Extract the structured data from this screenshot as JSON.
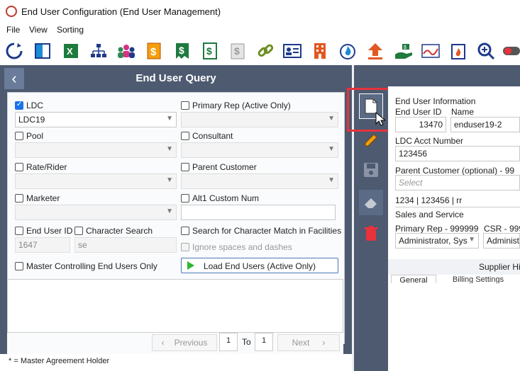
{
  "window": {
    "title": "End User Configuration (End User Management)"
  },
  "menu": [
    "File",
    "View",
    "Sorting"
  ],
  "toolbar_icons": [
    "refresh-icon",
    "panel-icon",
    "excel-icon",
    "hierarchy-icon",
    "users-icon",
    "dollar-doc-icon",
    "dollar-doc-green-icon",
    "dollar-doc-outline-icon",
    "dollar-doc-grey-icon",
    "link-icon",
    "contact-card-icon",
    "building-icon",
    "gas-flame-icon",
    "upload-icon",
    "hand-money-icon",
    "chart-line-icon",
    "flame-calendar-icon",
    "magnifier-plus-icon",
    "toggle-icon"
  ],
  "query": {
    "header": "End User Query",
    "ldc": {
      "label": "LDC",
      "checked": true,
      "value": "LDC19"
    },
    "primary_rep": {
      "label": "Primary Rep (Active Only)"
    },
    "pool": {
      "label": "Pool"
    },
    "consultant": {
      "label": "Consultant"
    },
    "rate_rider": {
      "label": "Rate/Rider"
    },
    "parent_customer": {
      "label": "Parent Customer"
    },
    "marketer": {
      "label": "Marketer"
    },
    "alt1": {
      "label": "Alt1 Custom Num"
    },
    "end_user_id": {
      "label": "End User ID",
      "value": "1647"
    },
    "char_search": {
      "label": "Character Search",
      "value": "se"
    },
    "search_facilities": {
      "label": "Search for Character Match in Facilities"
    },
    "ignore_spaces": {
      "label": "Ignore spaces and dashes"
    },
    "master_controlling": {
      "label": "Master Controlling End Users Only"
    },
    "load_button": "Load End Users (Active Only)"
  },
  "pager": {
    "previous": "Previous",
    "from": "1",
    "to_label": "To",
    "to": "1",
    "next": "Next"
  },
  "footer": "* = Master Agreement Holder",
  "detail": {
    "section_title": "End User Information",
    "end_user_id_label": "End User ID",
    "end_user_id": "13470",
    "name_label": "Name",
    "name": "enduser19-2",
    "ldc_acct_label": "LDC Acct Number",
    "ldc_acct": "123456",
    "parent_label": "Parent Customer (optional) - 99",
    "parent_placeholder": "Select",
    "parent_info": "1234  |  123456  |  rr",
    "sales_title": "Sales and Service",
    "primary_rep_label": "Primary Rep - 999999",
    "csr_label": "CSR - 999",
    "primary_rep_value": "Administrator, Sys",
    "csr_value": "Administ",
    "supplier_label": "Supplier Hi",
    "tab_general": "General",
    "tab_billing": "Billing Settings"
  }
}
